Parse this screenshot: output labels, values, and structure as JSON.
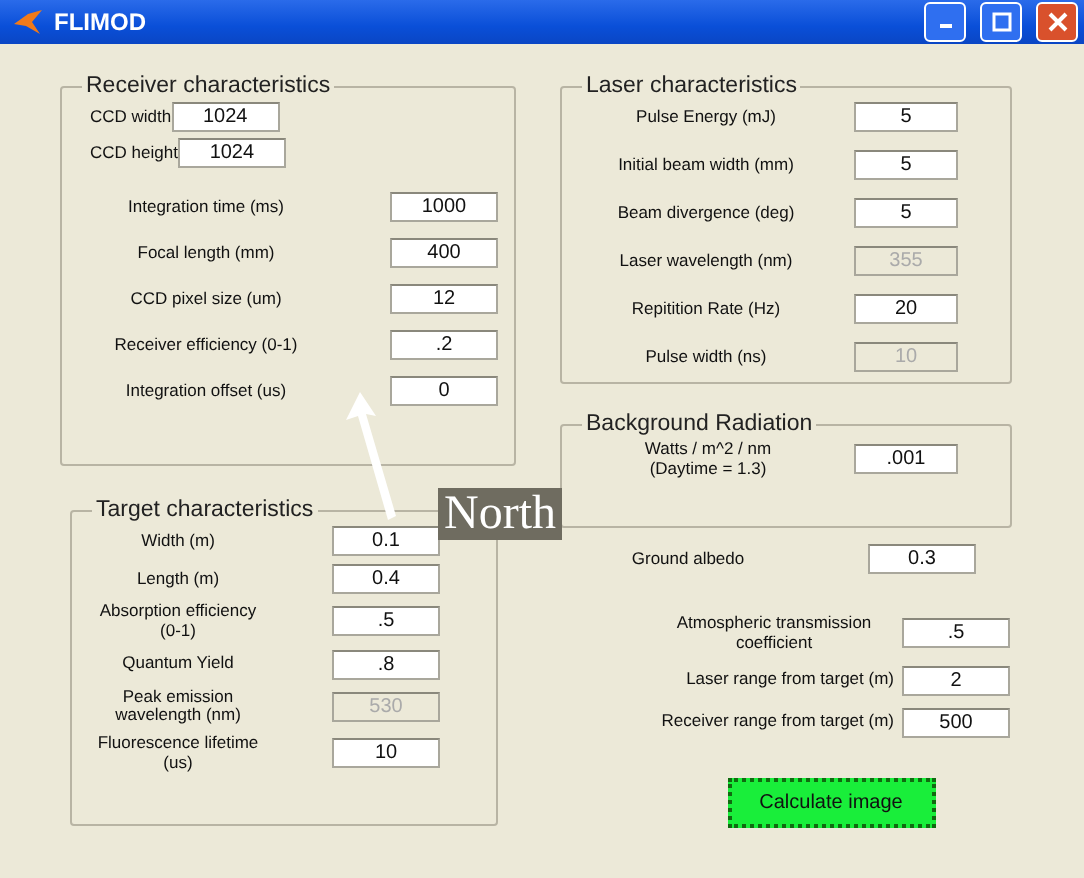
{
  "window": {
    "title": "FLIMOD"
  },
  "receiver": {
    "title": "Receiver characteristics",
    "fields": [
      {
        "kind": "compact",
        "label": "CCD width",
        "value": "1024",
        "disabled": false
      },
      {
        "kind": "compact",
        "label": "CCD height",
        "value": "1024",
        "disabled": false
      },
      {
        "kind": "row",
        "label": "Integration time (ms)",
        "value": "1000",
        "disabled": false
      },
      {
        "kind": "row",
        "label": "Focal length (mm)",
        "value": "400",
        "disabled": false
      },
      {
        "kind": "row",
        "label": "CCD pixel size (um)",
        "value": "12",
        "disabled": false
      },
      {
        "kind": "row",
        "label": "Receiver efficiency (0-1)",
        "value": ".2",
        "disabled": false
      },
      {
        "kind": "row",
        "label": "Integration offset (us)",
        "value": "0",
        "disabled": false
      }
    ]
  },
  "target": {
    "title": "Target characteristics",
    "fields": [
      {
        "label": "Width (m)",
        "value": "0.1",
        "disabled": false
      },
      {
        "label": "Length (m)",
        "value": "0.4",
        "disabled": false
      },
      {
        "label": "Absorption efficiency (0-1)",
        "value": ".5",
        "disabled": false
      },
      {
        "label": "Quantum Yield",
        "value": ".8",
        "disabled": false
      },
      {
        "label": "Peak emission wavelength (nm)",
        "value": "530",
        "disabled": true
      },
      {
        "label": "Fluorescence lifetime (us)",
        "value": "10",
        "disabled": false
      }
    ]
  },
  "laser": {
    "title": "Laser characteristics",
    "fields": [
      {
        "label": "Pulse Energy (mJ)",
        "value": "5",
        "disabled": false
      },
      {
        "label": "Initial beam width (mm)",
        "value": "5",
        "disabled": false
      },
      {
        "label": "Beam divergence (deg)",
        "value": "5",
        "disabled": false
      },
      {
        "label": "Laser wavelength (nm)",
        "value": "355",
        "disabled": true
      },
      {
        "label": "Repitition Rate (Hz)",
        "value": "20",
        "disabled": false
      },
      {
        "label": "Pulse width (ns)",
        "value": "10",
        "disabled": true
      }
    ]
  },
  "background": {
    "title": "Background Radiation",
    "label": "Watts /  m^2 / nm (Daytime = 1.3)",
    "value": ".001"
  },
  "ground": {
    "label": "Ground albedo",
    "value": "0.3"
  },
  "ranges": [
    {
      "label": "Atmospheric transmission coefficient",
      "value": ".5"
    },
    {
      "label": "Laser range from target (m)",
      "value": "2"
    },
    {
      "label": "Receiver range from target (m)",
      "value": "500"
    }
  ],
  "button": "Calculate image",
  "annotation": {
    "label": "North"
  }
}
